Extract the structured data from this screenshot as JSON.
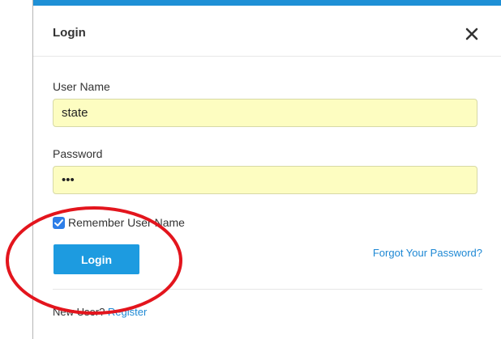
{
  "dialog": {
    "title": "Login"
  },
  "form": {
    "username_label": "User Name",
    "username_value": "state",
    "password_label": "Password",
    "password_value": "abc",
    "remember_label": "Remember User Name",
    "remember_checked": true,
    "login_label": "Login",
    "forgot_label": "Forgot Your Password?"
  },
  "footer": {
    "new_user_text": "New User?",
    "register_label": "Register"
  },
  "icons": {
    "close": "close-icon",
    "checkbox": "checkmark-icon"
  },
  "colors": {
    "accent": "#1d9be0",
    "input_bg": "#fdfdc1",
    "link": "#1e88d4",
    "annotation": "#e3151d"
  }
}
